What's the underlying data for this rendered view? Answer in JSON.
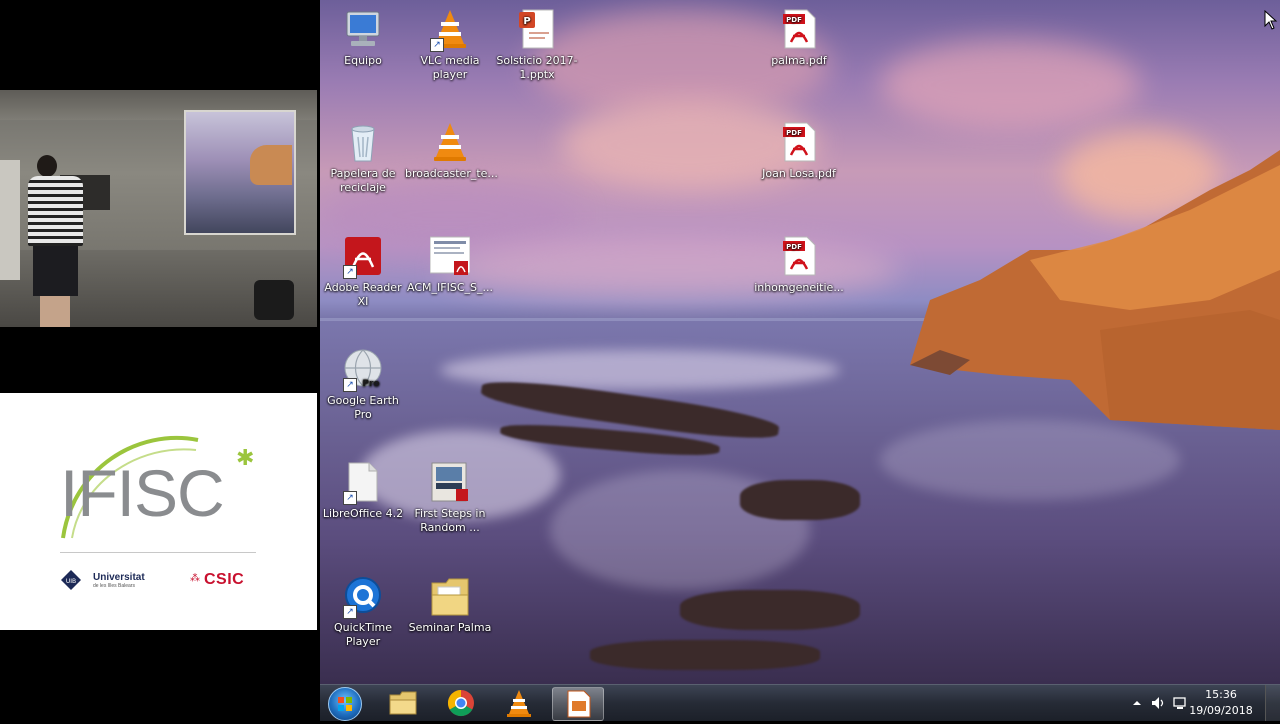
{
  "logo": {
    "name": "IFISC",
    "university": "Universitat",
    "university_sub": "de les Illes Balears",
    "csic": "CSIC",
    "colors": {
      "accent": "#9bc53d",
      "text": "#8a8c8f",
      "csic": "#c8102e",
      "uib": "#1d2a57"
    }
  },
  "desktop": {
    "icons": [
      {
        "label": "Equipo",
        "icon": "computer-icon"
      },
      {
        "label": "VLC media player",
        "icon": "vlc-icon"
      },
      {
        "label": "Solsticio 2017-1.pptx",
        "icon": "powerpoint-file-icon"
      },
      {
        "label": "palma.pdf",
        "icon": "pdf-file-icon"
      },
      {
        "label": "Papelera de reciclaje",
        "icon": "recycle-bin-icon"
      },
      {
        "label": "broadcaster_te...",
        "icon": "vlc-icon"
      },
      {
        "label": "Joan Losa.pdf",
        "icon": "pdf-file-icon"
      },
      {
        "label": "Adobe Reader XI",
        "icon": "adobe-reader-icon"
      },
      {
        "label": "ACM_IFISC_S_...",
        "icon": "pdf-document-icon"
      },
      {
        "label": "inhomgeneitie...",
        "icon": "pdf-file-icon"
      },
      {
        "label": "Google Earth Pro",
        "icon": "google-earth-icon"
      },
      {
        "label": "LibreOffice 4.2",
        "icon": "libreoffice-icon"
      },
      {
        "label": "First Steps in Random ...",
        "icon": "pdf-book-icon"
      },
      {
        "label": "QuickTime Player",
        "icon": "quicktime-icon"
      },
      {
        "label": "Seminar Palma",
        "icon": "folder-icon"
      }
    ],
    "pdf_badge": "PDF",
    "pro_badge": "Pro"
  },
  "taskbar": {
    "items": [
      {
        "name": "start-button",
        "icon": "windows-orb-icon"
      },
      {
        "name": "explorer",
        "icon": "folder-icon"
      },
      {
        "name": "chrome",
        "icon": "chrome-icon"
      },
      {
        "name": "vlc",
        "icon": "vlc-icon"
      },
      {
        "name": "impress",
        "icon": "impress-icon",
        "active": true
      }
    ],
    "clock": {
      "time": "15:36",
      "date": "19/09/2018"
    }
  }
}
